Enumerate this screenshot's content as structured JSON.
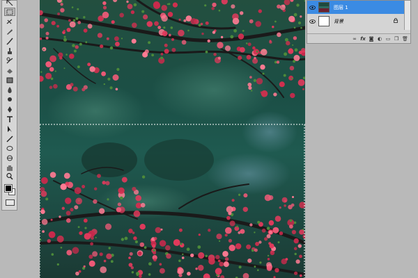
{
  "toolbox": {
    "tools": [
      "move-tool",
      "marquee-tool",
      "lasso-tool",
      "quick-selection-tool",
      "crop-tool",
      "eyedropper-tool",
      "healing-brush-tool",
      "brush-tool",
      "clone-stamp-tool",
      "history-brush-tool",
      "eraser-tool",
      "gradient-tool",
      "blur-tool",
      "dodge-tool",
      "pen-tool",
      "type-tool",
      "path-selection-tool",
      "shape-tool",
      "3d-rotate-tool",
      "3d-orbit-tool",
      "hand-tool",
      "zoom-tool"
    ],
    "foreground_color": "#000000",
    "background_color": "#ffffff"
  },
  "layers": {
    "items": [
      {
        "name": "图层 1",
        "selected": true,
        "visible": true,
        "locked": false
      },
      {
        "name": "背景",
        "selected": false,
        "visible": true,
        "locked": true
      }
    ],
    "footer_buttons": [
      "link-layers",
      "fx",
      "add-mask",
      "adjustment",
      "group",
      "new-layer",
      "delete"
    ]
  },
  "colors": {
    "selection": "#3b8be3",
    "workspace": "#b9b9b9",
    "blossom": "#e23a5c",
    "foliage": "#1d5a4d"
  }
}
